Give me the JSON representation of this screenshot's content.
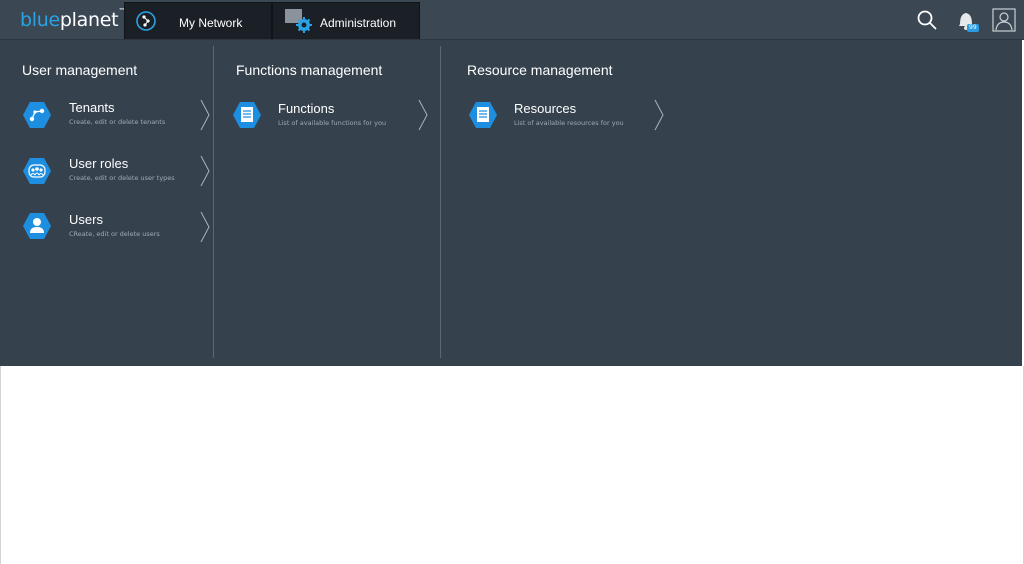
{
  "app": {
    "logo_part1": "blue",
    "logo_part2": "planet",
    "logo_tm": "™"
  },
  "nav": {
    "tabs": [
      {
        "label": "My Network",
        "icon": "network-compass-icon"
      },
      {
        "label": "Administration",
        "icon": "admin-gear-icon"
      }
    ],
    "icons": [
      "search-icon",
      "bell-icon",
      "user-profile-icon"
    ],
    "notification_count": "99"
  },
  "menu": {
    "columns": [
      {
        "title": "User management",
        "items": [
          {
            "title": "Tenants",
            "desc": "Create, edit or delete tenants",
            "icon": "tenants-icon"
          },
          {
            "title": "User roles",
            "desc": "Create, edit or delete user types",
            "icon": "user-roles-icon"
          },
          {
            "title": "Users",
            "desc": "CReate, edit or delete users",
            "icon": "users-icon"
          }
        ]
      },
      {
        "title": "Functions management",
        "items": [
          {
            "title": "Functions",
            "desc": "List of available functions for you",
            "icon": "document-icon"
          }
        ]
      },
      {
        "title": "Resource management",
        "items": [
          {
            "title": "Resources",
            "desc": "List of available resources for you",
            "icon": "document-icon"
          }
        ]
      }
    ]
  },
  "colors": {
    "accent": "#29a3e6",
    "panel": "#35424e",
    "topbar": "#3b4854"
  }
}
